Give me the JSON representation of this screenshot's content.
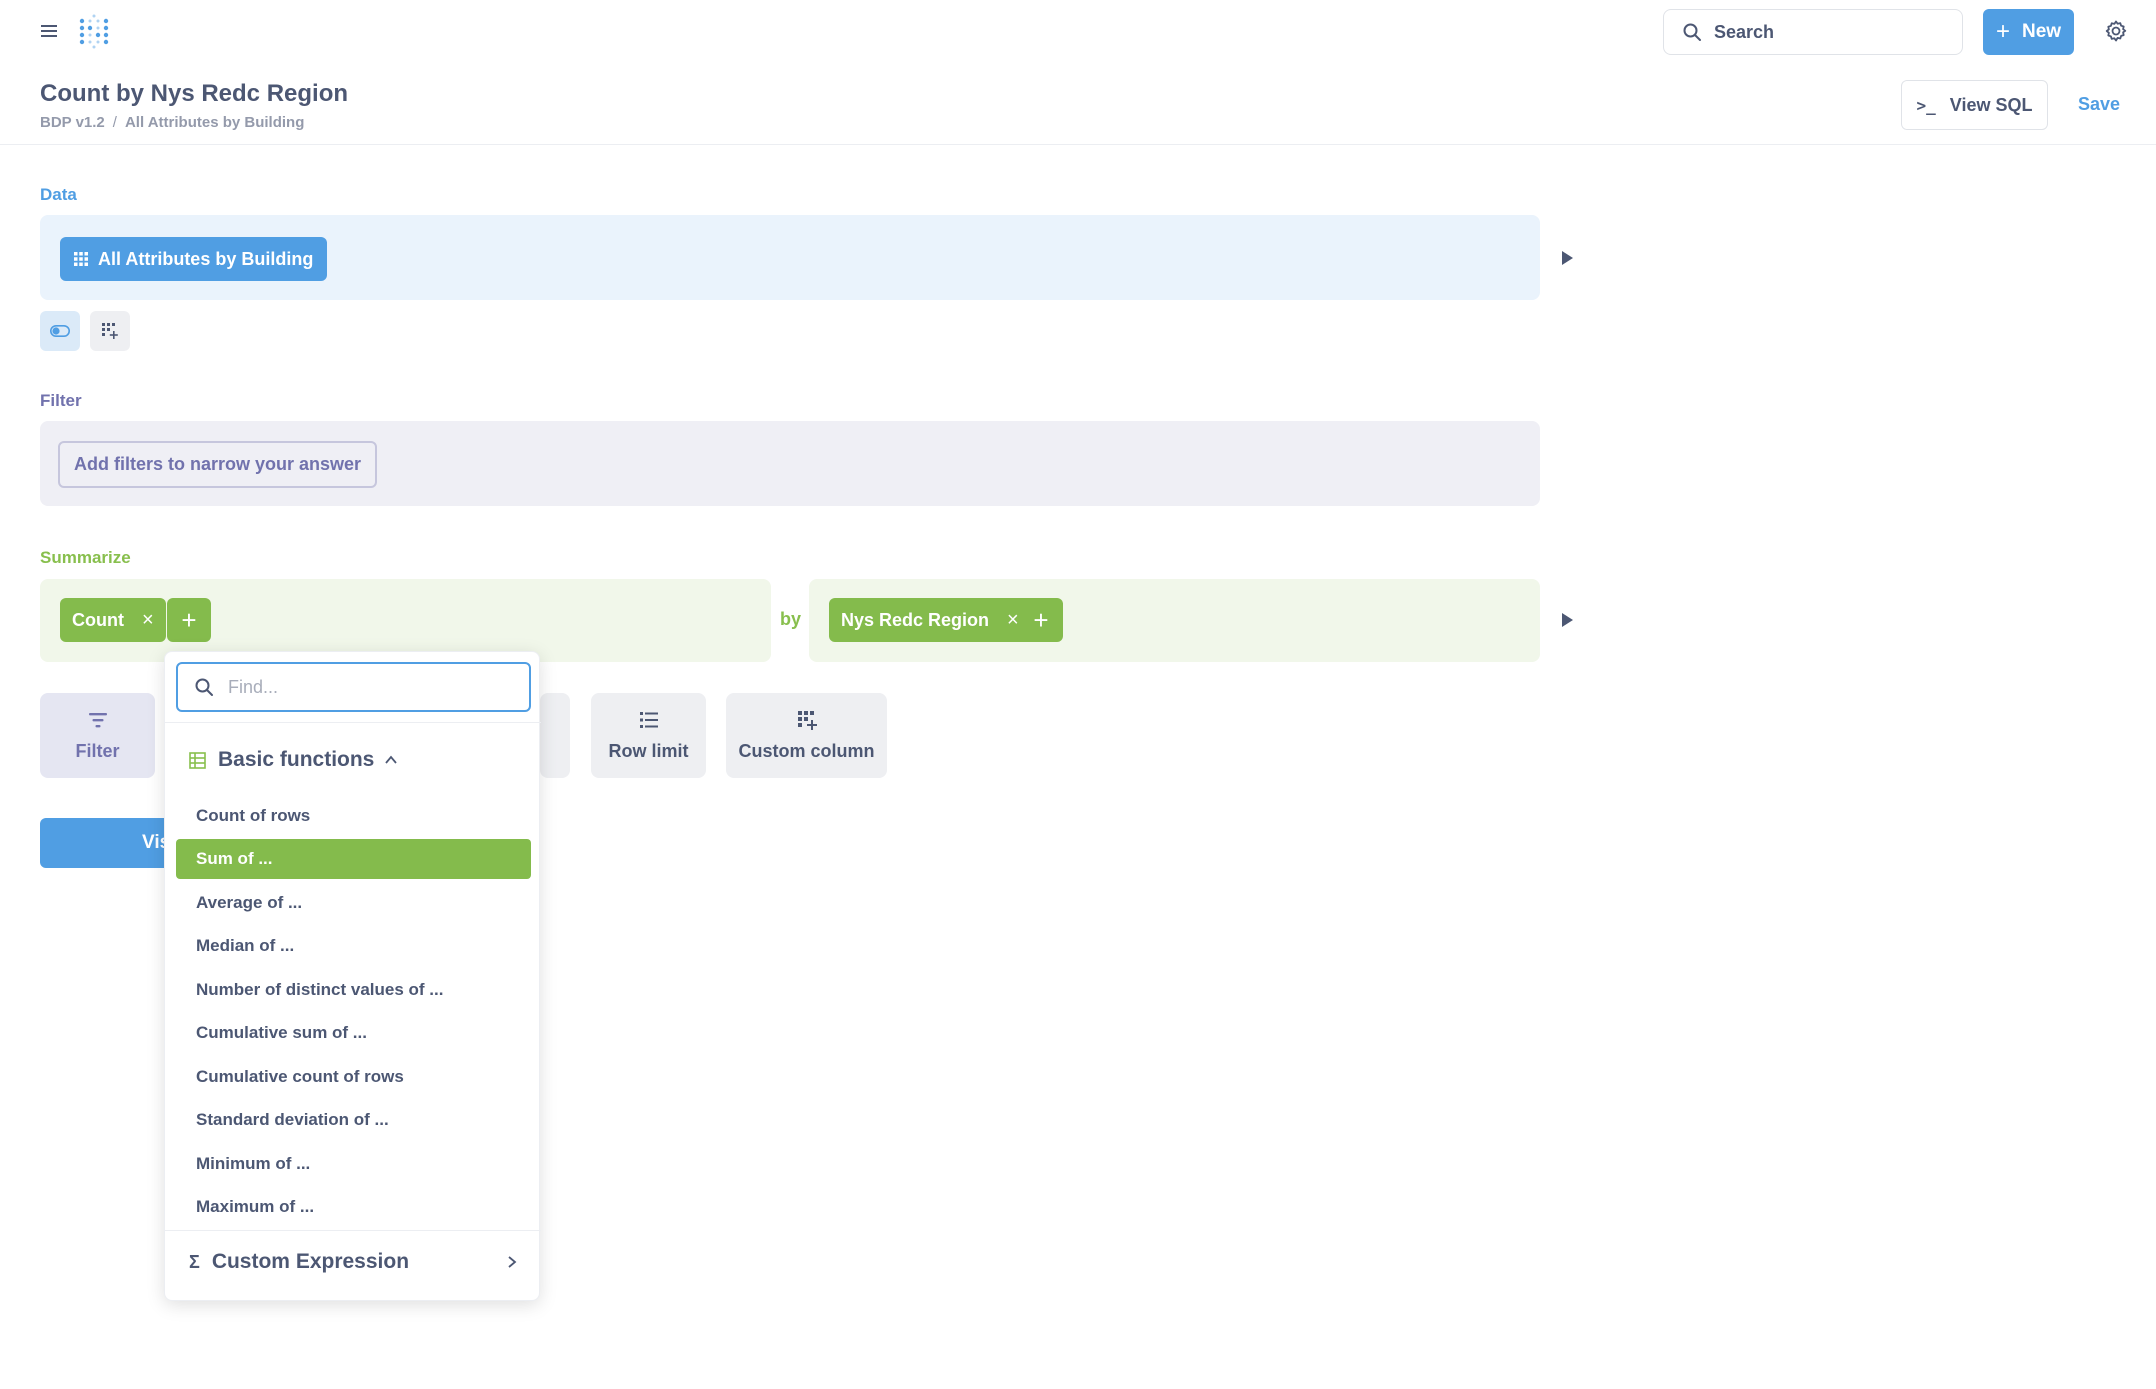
{
  "nav": {
    "search_label": "Search",
    "new_label": "New"
  },
  "header": {
    "title": "Count by Nys Redc Region",
    "breadcrumb": [
      "BDP v1.2",
      "All Attributes by Building"
    ],
    "breadcrumb_sep": "/",
    "view_sql_label": "View SQL",
    "save_label": "Save"
  },
  "data_section": {
    "label": "Data",
    "source": "All Attributes by Building"
  },
  "filter_section": {
    "label": "Filter",
    "placeholder_button": "Add filters to narrow your answer"
  },
  "summarize_section": {
    "label": "Summarize",
    "metric": "Count",
    "by_label": "by",
    "breakout": "Nys Redc Region"
  },
  "actions": {
    "filter": "Filter",
    "row_limit": "Row limit",
    "custom_column": "Custom column",
    "visualize": "Vis"
  },
  "popover": {
    "find_placeholder": "Find...",
    "group_title": "Basic functions",
    "items": [
      "Count of rows",
      "Sum of ...",
      "Average of ...",
      "Median of ...",
      "Number of distinct values of ...",
      "Cumulative sum of ...",
      "Cumulative count of rows",
      "Standard deviation of ...",
      "Minimum of ...",
      "Maximum of ..."
    ],
    "selected_index": 1,
    "custom_expression": "Custom Expression"
  },
  "colors": {
    "brand": "#509ee3",
    "summarize": "#88bf4d",
    "filter": "#7172ad",
    "text": "#4c5773"
  }
}
